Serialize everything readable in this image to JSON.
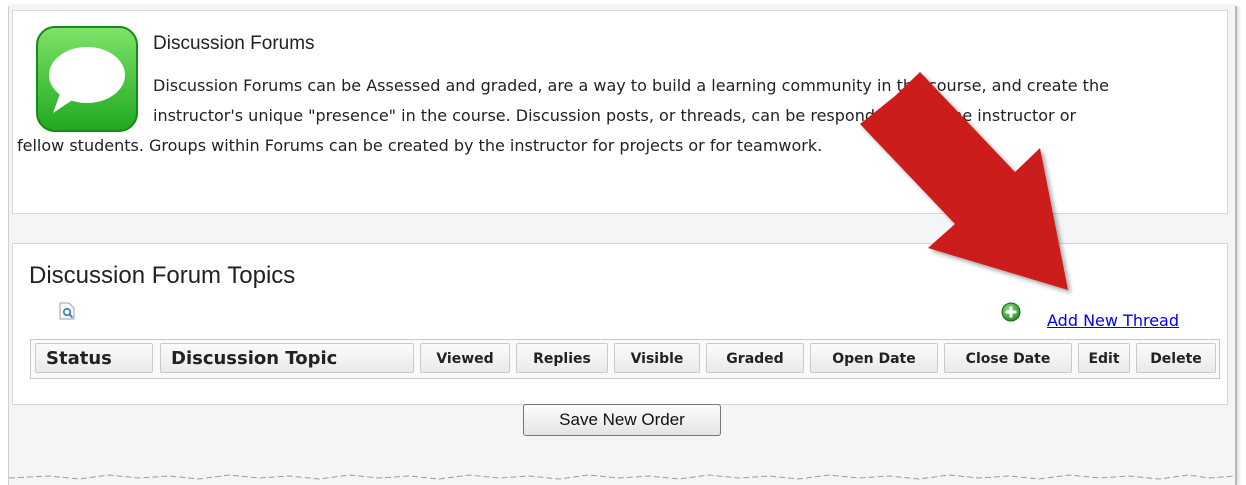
{
  "intro": {
    "title": "Discussion Forums",
    "text_lines": [
      "Discussion Forums can be Assessed and graded, are a way to build a learning community in the course, and create the",
      "instructor's unique \"presence\" in the course. Discussion posts, or threads, can be responded to by the instructor or",
      "fellow students. Groups within Forums can be created by the instructor for projects or for teamwork."
    ],
    "icon": "speech-bubble-icon"
  },
  "topics": {
    "title": "Discussion Forum Topics",
    "preview_icon": "preview-icon",
    "add_icon": "plus-circle-icon",
    "add_link": "Add New Thread",
    "columns": [
      "Status",
      "Discussion Topic",
      "Viewed",
      "Replies",
      "Visible",
      "Graded",
      "Open Date",
      "Close Date",
      "Edit",
      "Delete"
    ]
  },
  "actions": {
    "save_order": "Save New Order"
  },
  "colors": {
    "icon_green": "#3cc23c",
    "link": "#0000ee",
    "arrow": "#cc1a1a"
  }
}
